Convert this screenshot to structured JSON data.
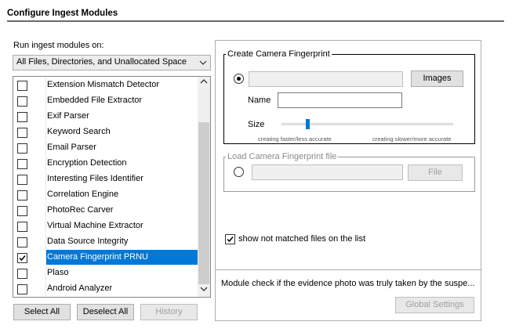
{
  "title": "Configure Ingest Modules",
  "run_on": {
    "label": "Run ingest modules on:",
    "selected": "All Files, Directories, and Unallocated Space"
  },
  "modules": [
    {
      "label": "Extension Mismatch Detector",
      "checked": false,
      "selected": false
    },
    {
      "label": "Embedded File Extractor",
      "checked": false,
      "selected": false
    },
    {
      "label": "Exif Parser",
      "checked": false,
      "selected": false
    },
    {
      "label": "Keyword Search",
      "checked": false,
      "selected": false
    },
    {
      "label": "Email Parser",
      "checked": false,
      "selected": false
    },
    {
      "label": "Encryption Detection",
      "checked": false,
      "selected": false
    },
    {
      "label": "Interesting Files Identifier",
      "checked": false,
      "selected": false
    },
    {
      "label": "Correlation Engine",
      "checked": false,
      "selected": false
    },
    {
      "label": "PhotoRec Carver",
      "checked": false,
      "selected": false
    },
    {
      "label": "Virtual Machine Extractor",
      "checked": false,
      "selected": false
    },
    {
      "label": "Data Source Integrity",
      "checked": false,
      "selected": false
    },
    {
      "label": "Camera Fingerprint PRNU",
      "checked": true,
      "selected": true
    },
    {
      "label": "Plaso",
      "checked": false,
      "selected": false
    },
    {
      "label": "Android Analyzer",
      "checked": false,
      "selected": false
    }
  ],
  "buttons": {
    "select_all": "Select All",
    "deselect_all": "Deselect All",
    "history": "History"
  },
  "create_fp": {
    "legend": "Create Camera Fingerprint",
    "images_button": "Images",
    "name_label": "Name",
    "size_label": "Size",
    "size_level": 0.15,
    "hint_left": "creating faster/less accurate",
    "hint_right": "creating slower/more accurate"
  },
  "load_fp": {
    "legend": "Load Camera Fingerprint file",
    "file_button": "File"
  },
  "show_not_matched": {
    "label": "show not matched files on the list",
    "checked": true
  },
  "description": "Module check if the evidence photo was truly taken by the suspe...",
  "global_settings": "Global Settings",
  "colors": {
    "selection": "#0078d7",
    "slider": "#0078d7"
  }
}
